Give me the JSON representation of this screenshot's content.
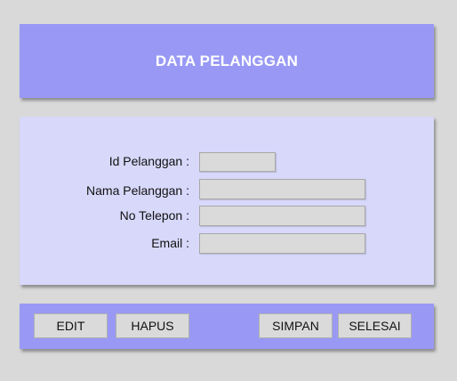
{
  "header": {
    "title": "DATA PELANGGAN"
  },
  "form": {
    "fields": [
      {
        "label": "Id Pelanggan :",
        "value": ""
      },
      {
        "label": "Nama Pelanggan :",
        "value": ""
      },
      {
        "label": "No Telepon :",
        "value": ""
      },
      {
        "label": "Email :",
        "value": ""
      }
    ]
  },
  "buttons": {
    "edit": "EDIT",
    "hapus": "HAPUS",
    "simpan": "SIMPAN",
    "selesai": "SELESAI"
  },
  "colors": {
    "header_bg": "#9999f5",
    "form_bg": "#d8d8fb",
    "page_bg": "#d9d9d9",
    "control_bg": "#dadada"
  }
}
